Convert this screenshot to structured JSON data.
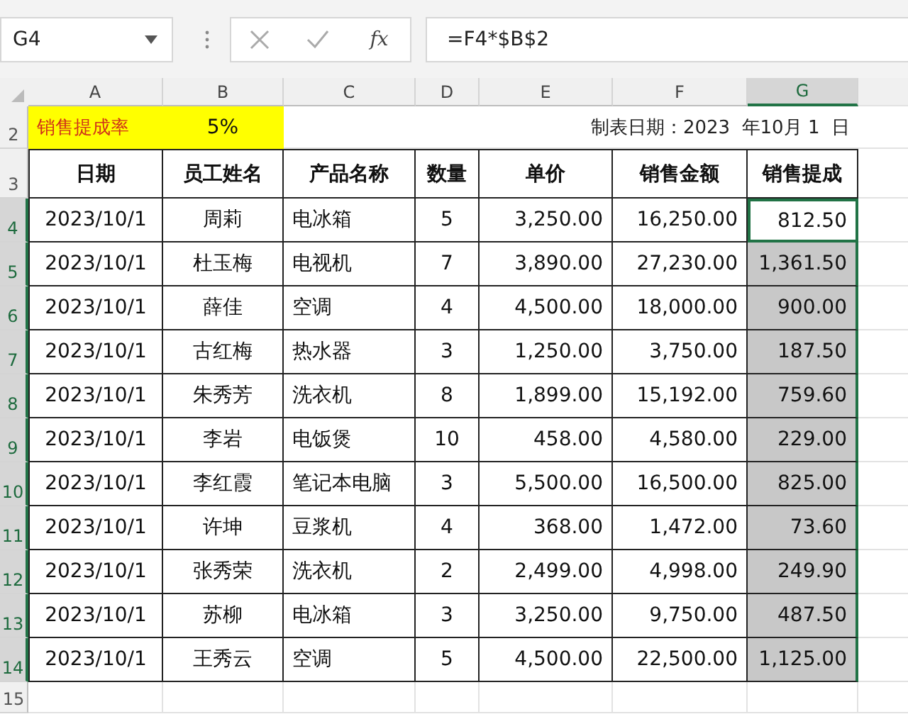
{
  "name_box": "G4",
  "formula_bar": {
    "function_label": "fx",
    "formula": "=F4*$B$2"
  },
  "columns": [
    {
      "label": "A",
      "selected": false
    },
    {
      "label": "B",
      "selected": false
    },
    {
      "label": "C",
      "selected": false
    },
    {
      "label": "D",
      "selected": false
    },
    {
      "label": "E",
      "selected": false
    },
    {
      "label": "F",
      "selected": false
    },
    {
      "label": "G",
      "selected": true
    }
  ],
  "rate_row": {
    "number": "2",
    "label": "销售提成率",
    "value": "5%",
    "date_text": "制表日期：2023  年10月 1  日"
  },
  "header_row": {
    "number": "3",
    "cells": [
      "日期",
      "员工姓名",
      "产品名称",
      "数量",
      "单价",
      "销售金额",
      "销售提成"
    ]
  },
  "rows": [
    {
      "number": "4",
      "selected": true,
      "active": true,
      "cells": [
        "2023/10/1",
        "周莉",
        "电冰箱",
        "5",
        "3,250.00",
        "16,250.00",
        "812.50"
      ]
    },
    {
      "number": "5",
      "selected": true,
      "active": false,
      "cells": [
        "2023/10/1",
        "杜玉梅",
        "电视机",
        "7",
        "3,890.00",
        "27,230.00",
        "1,361.50"
      ]
    },
    {
      "number": "6",
      "selected": true,
      "active": false,
      "cells": [
        "2023/10/1",
        "薛佳",
        "空调",
        "4",
        "4,500.00",
        "18,000.00",
        "900.00"
      ]
    },
    {
      "number": "7",
      "selected": true,
      "active": false,
      "cells": [
        "2023/10/1",
        "古红梅",
        "热水器",
        "3",
        "1,250.00",
        "3,750.00",
        "187.50"
      ]
    },
    {
      "number": "8",
      "selected": true,
      "active": false,
      "cells": [
        "2023/10/1",
        "朱秀芳",
        "洗衣机",
        "8",
        "1,899.00",
        "15,192.00",
        "759.60"
      ]
    },
    {
      "number": "9",
      "selected": true,
      "active": false,
      "cells": [
        "2023/10/1",
        "李岩",
        "电饭煲",
        "10",
        "458.00",
        "4,580.00",
        "229.00"
      ]
    },
    {
      "number": "10",
      "selected": true,
      "active": false,
      "cells": [
        "2023/10/1",
        "李红霞",
        "笔记本电脑",
        "3",
        "5,500.00",
        "16,500.00",
        "825.00"
      ]
    },
    {
      "number": "11",
      "selected": true,
      "active": false,
      "cells": [
        "2023/10/1",
        "许坤",
        "豆浆机",
        "4",
        "368.00",
        "1,472.00",
        "73.60"
      ]
    },
    {
      "number": "12",
      "selected": true,
      "active": false,
      "cells": [
        "2023/10/1",
        "张秀荣",
        "洗衣机",
        "2",
        "2,499.00",
        "4,998.00",
        "249.90"
      ]
    },
    {
      "number": "13",
      "selected": true,
      "active": false,
      "cells": [
        "2023/10/1",
        "苏柳",
        "电冰箱",
        "3",
        "3,250.00",
        "9,750.00",
        "487.50"
      ]
    },
    {
      "number": "14",
      "selected": true,
      "active": false,
      "cells": [
        "2023/10/1",
        "王秀云",
        "空调",
        "5",
        "4,500.00",
        "22,500.00",
        "1,125.00"
      ]
    }
  ],
  "empty_rows": [
    "15"
  ]
}
